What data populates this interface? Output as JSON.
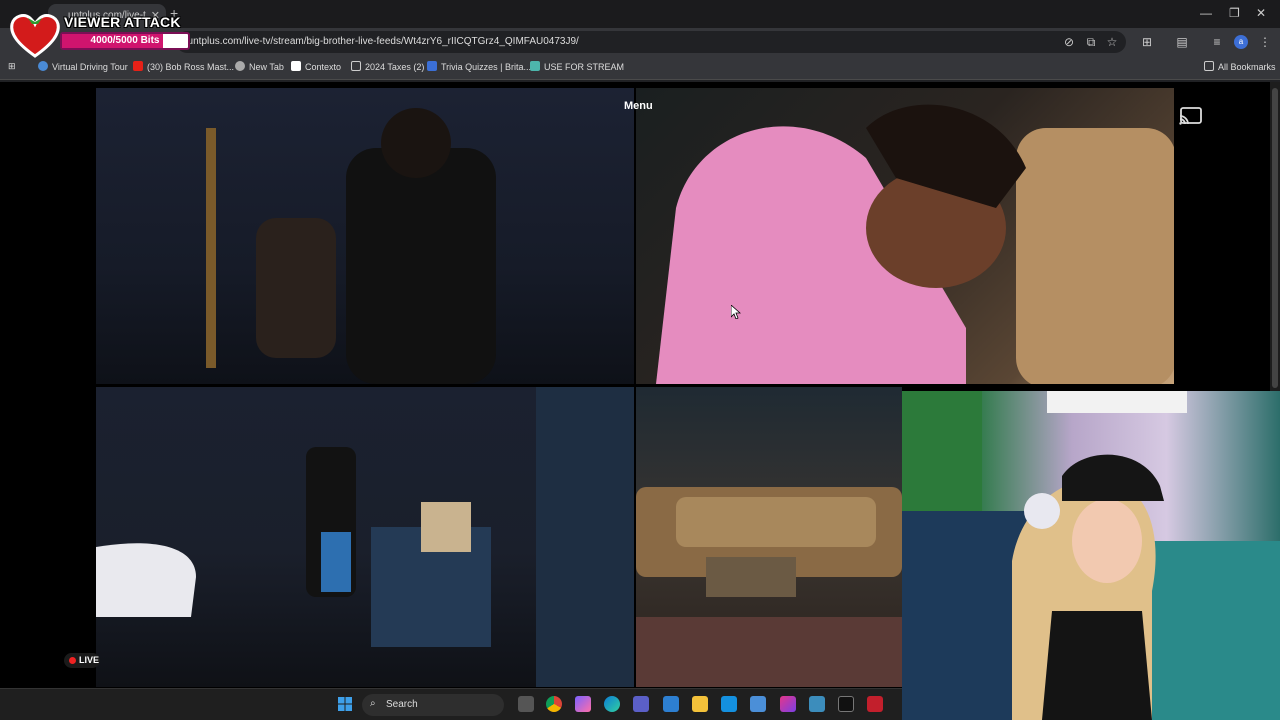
{
  "browser": {
    "tab_title": "untplus.com/live-t",
    "address": "ountplus.com/live-tv/stream/big-brother-live-feeds/Wt4zrY6_rIICQTGrz4_QIMFAU0473J9/",
    "bookmarks": [
      {
        "label": "Virtual Driving Tour",
        "color": "#4a8bd6"
      },
      {
        "label": "(30) Bob Ross Mast...",
        "color": "#e62117"
      },
      {
        "label": "New Tab",
        "color": "#aaaaaa"
      },
      {
        "label": "Contexto",
        "color": "#ffffff"
      },
      {
        "label": "2024 Taxes (2)",
        "color": "#cccccc"
      },
      {
        "label": "Trivia Quizzes | Brita...",
        "color": "#3b6fd6"
      },
      {
        "label": "USE FOR STREAM",
        "color": "#4db6ac"
      }
    ],
    "all_bookmarks": "All Bookmarks"
  },
  "overlay": {
    "title": "VIEWER ATTACK",
    "progress_text": "4000/5000 Bits",
    "progress_fraction": 0.8,
    "accent": "#d0146e"
  },
  "player": {
    "menu_label": "Menu",
    "live_label": "LIVE",
    "cast_icon": "cast-icon"
  },
  "taskbar": {
    "search_placeholder": "Search",
    "icons": [
      "widgets-icon",
      "task-view-icon",
      "chrome-icon",
      "copilot-icon",
      "edge-icon",
      "teams-icon",
      "photos-icon",
      "file-explorer-icon",
      "outlook-icon",
      "store-icon",
      "m365-icon",
      "app-icon",
      "capcut-icon",
      "game-icon"
    ]
  }
}
